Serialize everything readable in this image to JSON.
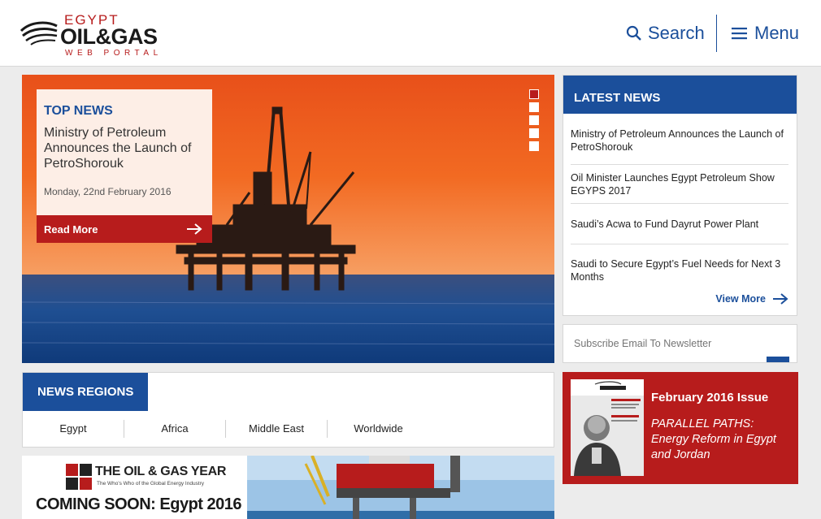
{
  "header": {
    "logo": {
      "line1": "EGYPT",
      "line2": "OIL&GAS",
      "line3": "WEB PORTAL"
    },
    "search_label": "Search",
    "menu_label": "Menu"
  },
  "hero": {
    "label": "TOP NEWS",
    "title": "Ministry of Petroleum Announces the Launch of PetroShorouk",
    "date": "Monday, 22nd February 2016",
    "read_more": "Read More",
    "slide_count": 5,
    "active_slide": 1
  },
  "latest_news": {
    "heading": "LATEST NEWS",
    "items": [
      {
        "title": "Ministry of Petroleum Announces the Launch of PetroShorouk"
      },
      {
        "title": "Oil Minister Launches Egypt Petroleum Show EGYPS 2017"
      },
      {
        "title": "Saudi’s Acwa to Fund Dayrut Power Plant"
      },
      {
        "title": "Saudi to Secure Egypt’s Fuel Needs for Next 3 Months"
      }
    ],
    "view_more": "View More"
  },
  "subscribe": {
    "placeholder": "Subscribe Email To Newsletter"
  },
  "regions": {
    "heading": "NEWS REGIONS",
    "tabs": [
      "Egypt",
      "Africa",
      "Middle East",
      "Worldwide"
    ]
  },
  "issue": {
    "title": "February 2016 Issue",
    "description": "PARALLEL PATHS: Energy Reform in Egypt and Jordan"
  },
  "banner": {
    "brand": "THE OIL & GAS YEAR",
    "tagline": "The Who's Who of the Global Energy Industry",
    "headline": "COMING SOON: Egypt 2016"
  },
  "colors": {
    "brand_blue": "#1b4f9b",
    "brand_red": "#b71c1c"
  }
}
